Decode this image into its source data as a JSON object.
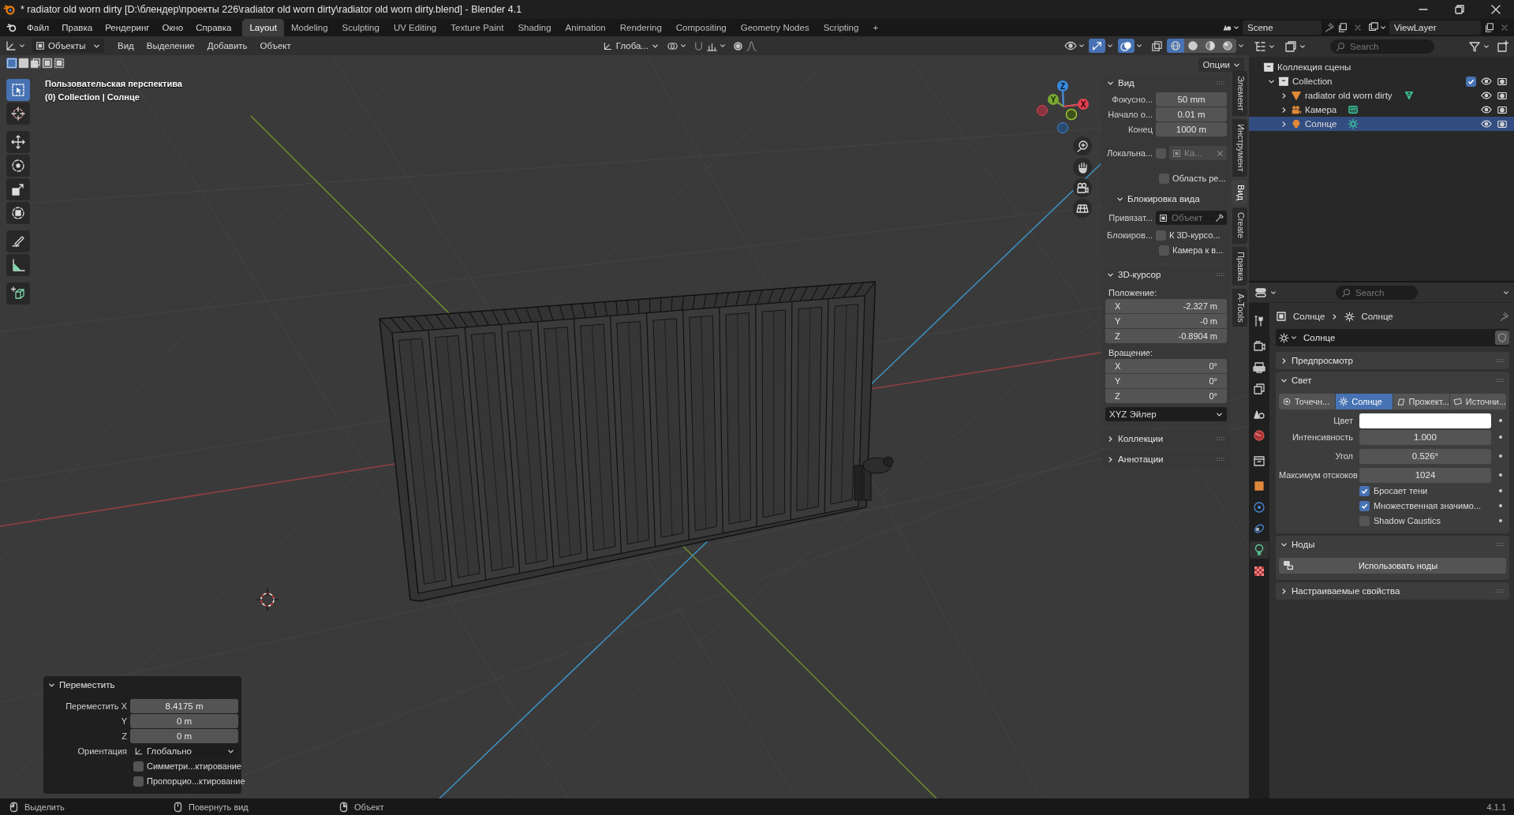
{
  "window": {
    "title": "* radiator old worn dirty [D:\\блендер\\проекты 226\\radiator old worn dirty\\radiator old worn dirty.blend] - Blender 4.1"
  },
  "menu": [
    "Файл",
    "Правка",
    "Рендеринг",
    "Окно",
    "Справка"
  ],
  "workspaces": [
    {
      "label": "Layout",
      "selected": true
    },
    {
      "label": "Modeling",
      "selected": false
    },
    {
      "label": "Sculpting",
      "selected": false
    },
    {
      "label": "UV Editing",
      "selected": false
    },
    {
      "label": "Texture Paint",
      "selected": false
    },
    {
      "label": "Shading",
      "selected": false
    },
    {
      "label": "Animation",
      "selected": false
    },
    {
      "label": "Rendering",
      "selected": false
    },
    {
      "label": "Compositing",
      "selected": false
    },
    {
      "label": "Geometry Nodes",
      "selected": false
    },
    {
      "label": "Scripting",
      "selected": false
    }
  ],
  "add_workspace": "+",
  "scene": "Scene",
  "view_layer": "ViewLayer",
  "viewport": {
    "mode": "Объекты",
    "menus": [
      "Вид",
      "Выделение",
      "Добавить",
      "Объект"
    ],
    "orientation": "Глоба...",
    "shading": [
      {
        "selected": true
      },
      {
        "selected": false
      },
      {
        "selected": false
      },
      {
        "selected": false
      }
    ],
    "select_modes": [
      {
        "selected": true
      },
      {
        "selected": false
      },
      {
        "selected": false
      },
      {
        "selected": false
      },
      {
        "selected": false
      }
    ],
    "options": "Опции",
    "info": [
      "Пользовательская перспектива",
      "(0) Collection | Солнце"
    ],
    "tools": [
      {
        "selected": true
      },
      {
        "selected": false
      },
      {
        "selected": false
      },
      {
        "selected": false
      },
      {
        "selected": false
      },
      {
        "selected": false
      },
      {
        "selected": false
      },
      {
        "selected": false
      },
      {
        "selected": false
      }
    ],
    "gizmo_axes": [
      "X",
      "Y",
      "Z"
    ]
  },
  "sidebar": {
    "tabs": [
      {
        "label": "Элемент",
        "selected": false
      },
      {
        "label": "Инструмент",
        "selected": false
      },
      {
        "label": "Вид",
        "selected": true
      },
      {
        "label": "Create",
        "selected": false
      },
      {
        "label": "Правка",
        "selected": false
      },
      {
        "label": "A-Tools",
        "selected": false
      }
    ],
    "view": {
      "title": "Вид",
      "expanded": true,
      "fields": [
        {
          "label": "Фокусно...",
          "value": "50 mm"
        },
        {
          "label": "Начало о...",
          "value": "0.01 m"
        },
        {
          "label": "Конец",
          "value": "1000 m"
        }
      ],
      "local_camera": {
        "label": "Локальна...",
        "checked": false,
        "value": "Ка...",
        "disabled": true
      },
      "render_region": {
        "label": "Область ре...",
        "checked": false
      },
      "lock": {
        "title": "Блокировка вида",
        "expanded": true,
        "object_label": "Привязат...",
        "object_placeholder": "Объект",
        "lock_label": "Блокиров...",
        "options": [
          {
            "label": "К 3D-курсо...",
            "checked": false
          },
          {
            "label": "Камера к в...",
            "checked": false
          }
        ]
      }
    },
    "cursor": {
      "title": "3D-курсор",
      "expanded": true,
      "location_label": "Положение:",
      "location": [
        {
          "axis": "X",
          "value": "-2.327 m"
        },
        {
          "axis": "Y",
          "value": "-0 m"
        },
        {
          "axis": "Z",
          "value": "-0.8904 m"
        }
      ],
      "rotation_label": "Вращение:",
      "rotation": [
        {
          "axis": "X",
          "value": "0°"
        },
        {
          "axis": "Y",
          "value": "0°"
        },
        {
          "axis": "Z",
          "value": "0°"
        }
      ],
      "rotation_mode": "XYZ Эйлер"
    },
    "more_panels": [
      {
        "title": "Коллекции",
        "expanded": false
      },
      {
        "title": "Аннотации",
        "expanded": false
      }
    ]
  },
  "operator": {
    "title": "Переместить",
    "expanded": true,
    "fields": [
      {
        "label": "Переместить X",
        "value": "8.4175 m"
      },
      {
        "label": "Y",
        "value": "0 m"
      },
      {
        "label": "Z",
        "value": "0 m"
      }
    ],
    "orientation": {
      "label": "Ориентация",
      "value": "Глобально"
    },
    "options": [
      {
        "label": "Симметри...ктирование",
        "checked": false
      },
      {
        "label": "Пропорцио...ктирование",
        "checked": false
      }
    ]
  },
  "outliner": {
    "search_placeholder": "Search",
    "root": "Коллекция сцены",
    "items": [
      {
        "name": "Collection",
        "kind": "collection",
        "expanded": true,
        "checked": true,
        "selected": false,
        "children": [
          {
            "name": "radiator old worn dirty",
            "kind": "mesh",
            "expanded": false,
            "selected": false
          },
          {
            "name": "Камера",
            "kind": "camera",
            "expanded": false,
            "selected": false
          },
          {
            "name": "Солнце",
            "kind": "light",
            "expanded": false,
            "selected": true
          }
        ]
      }
    ]
  },
  "properties": {
    "search_placeholder": "Search",
    "tabs": [
      {
        "selected": false
      },
      {
        "selected": false
      },
      {
        "selected": false
      },
      {
        "selected": false
      },
      {
        "selected": false
      },
      {
        "selected": false
      },
      {
        "selected": false
      },
      {
        "selected": false
      },
      {
        "selected": false
      },
      {
        "selected": false
      },
      {
        "selected": true
      },
      {
        "selected": false
      }
    ],
    "breadcrumb": [
      "Солнце",
      "Солнце"
    ],
    "datablock": "Солнце",
    "panels": [
      {
        "kind": "plain",
        "title": "Предпросмотр",
        "expanded": false
      },
      {
        "kind": "light",
        "title": "Свет",
        "expanded": true,
        "types": [
          {
            "label": "Точечн...",
            "selected": false
          },
          {
            "label": "Солнце",
            "selected": true
          },
          {
            "label": "Прожект...",
            "selected": false
          },
          {
            "label": "Источни...",
            "selected": false
          }
        ],
        "color": {
          "label": "Цвет",
          "color": "#ffffff"
        },
        "fields": [
          {
            "label": "Интенсивность",
            "value": "1.000"
          },
          {
            "label": "Угол",
            "value": "0.526°"
          },
          {
            "label": "Максимум отскоков",
            "value": "1024"
          }
        ],
        "options": [
          {
            "label": "Бросает тени",
            "checked": true
          },
          {
            "label": "Множественная значимо...",
            "checked": true
          },
          {
            "label": "Shadow Caustics",
            "checked": false
          }
        ]
      },
      {
        "kind": "nodes",
        "title": "Ноды",
        "expanded": true,
        "button": "Использовать ноды"
      },
      {
        "kind": "plain",
        "title": "Настраиваемые свойства",
        "expanded": false
      }
    ]
  },
  "status_bar": {
    "hints": [
      "Выделить",
      "Повернуть вид",
      "Объект"
    ],
    "version": "4.1.1"
  }
}
